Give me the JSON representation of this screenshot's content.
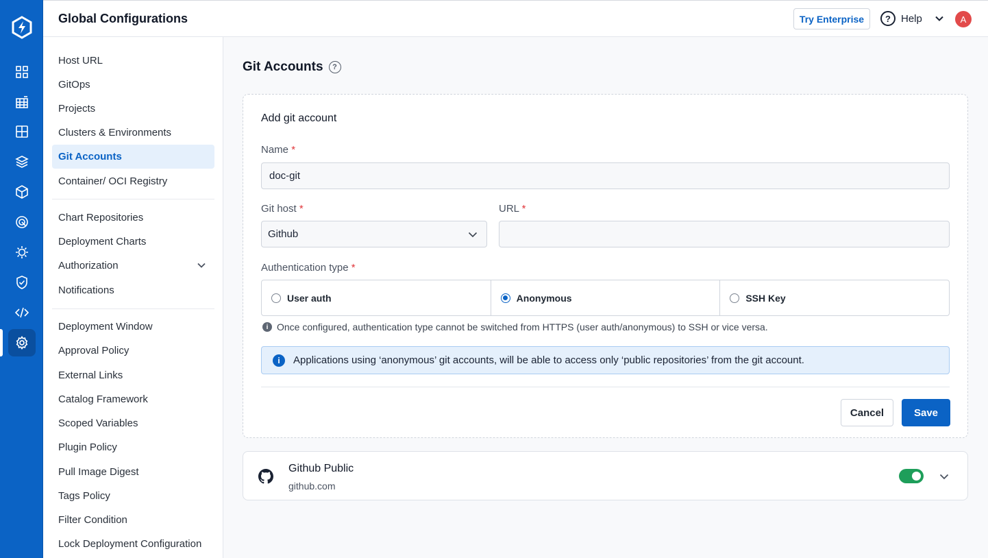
{
  "header": {
    "title": "Global Configurations",
    "try_enterprise": "Try Enterprise",
    "help": "Help",
    "avatar_initial": "A"
  },
  "rail": {
    "icons": [
      "devtron-logo-icon",
      "app-grid-icon",
      "chart-table-icon",
      "dashboard-grid-icon",
      "stack-layers-icon",
      "cube-icon",
      "target-icon",
      "gear-bug-icon",
      "shield-check-icon",
      "code-icon",
      "settings-gear-icon"
    ],
    "active": "settings-gear-icon",
    "accent": "#0b63c5"
  },
  "subnav": {
    "items": [
      "Host URL",
      "GitOps",
      "Projects",
      "Clusters & Environments",
      "Git Accounts",
      "Container/ OCI Registry",
      "Chart Repositories",
      "Deployment Charts",
      "Authorization",
      "Notifications",
      "Deployment Window",
      "Approval Policy",
      "External Links",
      "Catalog Framework",
      "Scoped Variables",
      "Plugin Policy",
      "Pull Image Digest",
      "Tags Policy",
      "Filter Condition",
      "Lock Deployment Configuration"
    ],
    "active": "Git Accounts"
  },
  "main": {
    "title": "Git Accounts",
    "form": {
      "title": "Add git account",
      "name_label": "Name",
      "name_value": "doc-git",
      "git_host_label": "Git host",
      "git_host_value": "Github",
      "url_label": "URL",
      "url_value": "",
      "auth_label": "Authentication type",
      "required_mark": "*",
      "auth_options": [
        "User auth",
        "Anonymous",
        "SSH Key"
      ],
      "auth_selected": "Anonymous",
      "note": "Once configured, authentication type cannot be switched from HTTPS (user auth/anonymous) to SSH or vice versa.",
      "info": "Applications using ‘anonymous’ git accounts, will be able to access only ‘public repositories’ from the git account.",
      "cancel": "Cancel",
      "save": "Save"
    },
    "accounts": [
      {
        "name": "Github Public",
        "host": "github.com",
        "enabled": true,
        "toggle_color": "#1e9e5a"
      }
    ]
  }
}
